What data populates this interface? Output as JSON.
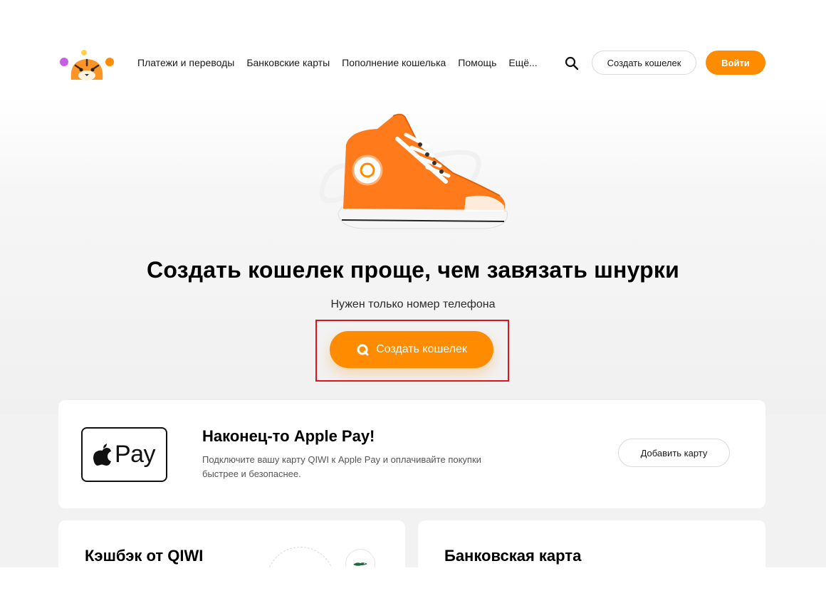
{
  "header": {
    "nav": [
      {
        "label": "Платежи и переводы"
      },
      {
        "label": "Банковские карты"
      },
      {
        "label": "Пополнение кошелька"
      },
      {
        "label": "Помощь"
      },
      {
        "label": "Ещё..."
      }
    ],
    "create_wallet_label": "Создать кошелек",
    "login_label": "Войти"
  },
  "hero": {
    "title": "Создать кошелек проще, чем завязать шнурки",
    "subtitle": "Нужен только номер телефона",
    "cta_label": "Создать кошелек"
  },
  "apple_pay": {
    "logo_text": "Pay",
    "title": "Наконец-то Apple Pay!",
    "description": "Подключите вашу карту QIWI к Apple Pay и оплачивайте покупки быстрее и безопаснее.",
    "button_label": "Добавить карту"
  },
  "cashback": {
    "title": "Кэшбэк от QIWI"
  },
  "bank_card": {
    "title": "Банковская карта"
  },
  "colors": {
    "accent": "#ff8c00",
    "highlight": "#e0141e",
    "text": "#000000"
  },
  "icons": {
    "logo": "qiwi-tiger-logo",
    "search": "search-icon",
    "cta": "qiwi-q-icon",
    "apple": "apple-icon"
  }
}
